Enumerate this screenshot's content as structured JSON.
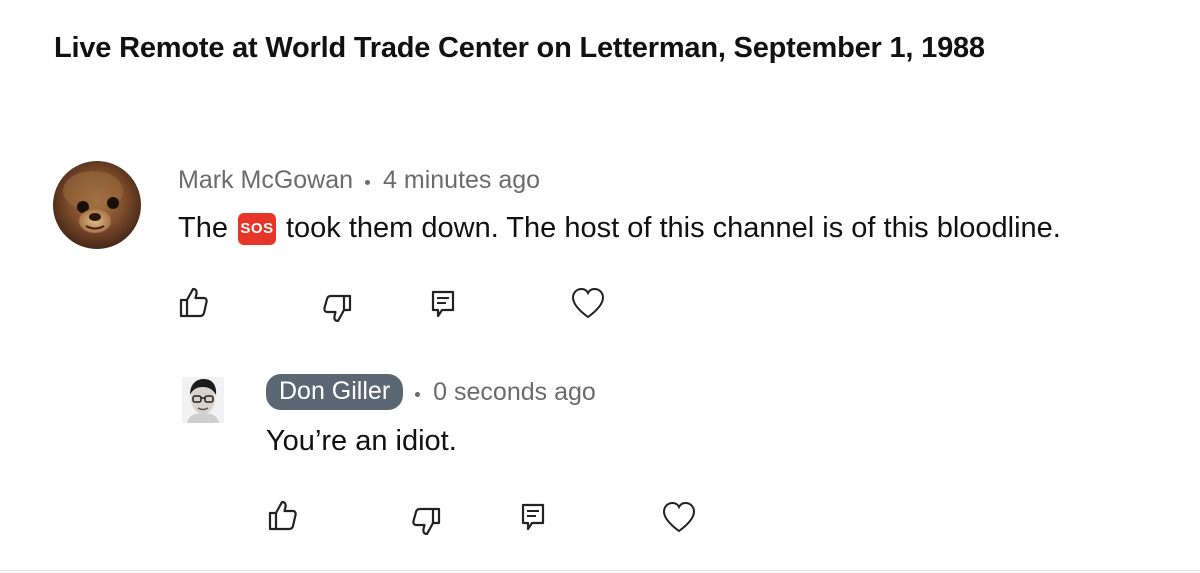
{
  "video": {
    "title": "Live Remote at World Trade Center on Letterman, September 1, 1988"
  },
  "comment": {
    "author": "Mark McGowan",
    "time": "4 minutes ago",
    "text_before": "The",
    "emoji_label": "SOS",
    "text_after": "took them down. The host of this channel is of this bloodline.",
    "emoji_color": "#e8352a",
    "actions": [
      "thumbs-up-icon",
      "thumbs-down-icon",
      "reply-icon",
      "heart-icon"
    ]
  },
  "reply": {
    "author": "Don Giller",
    "time": "0 seconds ago",
    "text": "You’re an idiot.",
    "author_pill_color": "#5b6873",
    "actions": [
      "thumbs-up-icon",
      "thumbs-down-icon",
      "reply-icon",
      "heart-icon"
    ]
  }
}
